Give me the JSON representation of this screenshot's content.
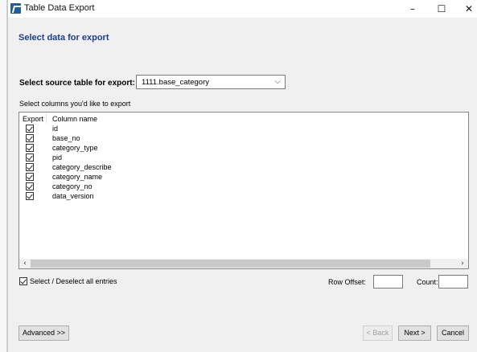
{
  "window": {
    "title": "Table Data Export"
  },
  "titlebar_controls": {
    "minimize": "–",
    "maximize": "☐",
    "close": "✕"
  },
  "header": {
    "heading": "Select data for export"
  },
  "source": {
    "label": "Select source table for export:",
    "selected": "1111.base_category"
  },
  "columns": {
    "label": "Select columns you'd like to export",
    "header_export": "Export",
    "header_column": "Column name",
    "items": [
      {
        "name": "id",
        "checked": true
      },
      {
        "name": "base_no",
        "checked": true
      },
      {
        "name": "category_type",
        "checked": true
      },
      {
        "name": "pid",
        "checked": true
      },
      {
        "name": "category_describe",
        "checked": true
      },
      {
        "name": "category_name",
        "checked": true
      },
      {
        "name": "category_no",
        "checked": true
      },
      {
        "name": "data_version",
        "checked": true
      }
    ]
  },
  "scroll": {
    "left": "‹",
    "right": "›"
  },
  "select_all": {
    "label": "Select / Deselect all entries",
    "checked": true
  },
  "row_offset": {
    "label": "Row Offset:",
    "value": ""
  },
  "count": {
    "label": "Count:",
    "value": ""
  },
  "buttons": {
    "advanced": "Advanced >>",
    "back": "< Back",
    "next": "Next >",
    "cancel": "Cancel"
  }
}
